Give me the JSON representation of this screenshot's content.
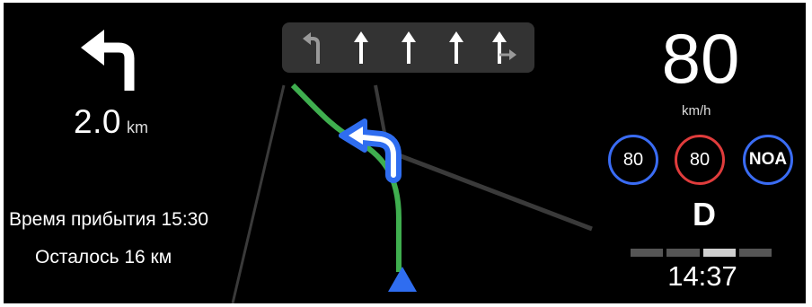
{
  "navigation": {
    "next_turn": {
      "icon": "turn-left-arrow-icon",
      "distance_value": "2.0",
      "distance_unit": "km"
    },
    "arrival_text": "Время прибытия 15:30",
    "remaining_text": "Осталось 16 км"
  },
  "lane_guidance": {
    "lanes": [
      {
        "icon": "lane-turn-left-icon",
        "recommended": false
      },
      {
        "icon": "lane-straight-icon",
        "recommended": true
      },
      {
        "icon": "lane-straight-icon",
        "recommended": true
      },
      {
        "icon": "lane-straight-icon",
        "recommended": true
      },
      {
        "icon": "lane-straight-right-icon",
        "recommended": true
      }
    ]
  },
  "dashboard": {
    "speed": "80",
    "speed_unit": "km/h",
    "badges": [
      {
        "label": "80",
        "color": "#3a6cf4"
      },
      {
        "label": "80",
        "color": "#e03c3c"
      },
      {
        "label": "NOA",
        "color": "#3a6cf4"
      }
    ],
    "gear": "D",
    "time": "14:37"
  },
  "colors": {
    "route": "#3fae4f",
    "maneuver": "#2f6df0",
    "road": "#3a3a3a",
    "vehicle_marker": "#2f6df0"
  }
}
